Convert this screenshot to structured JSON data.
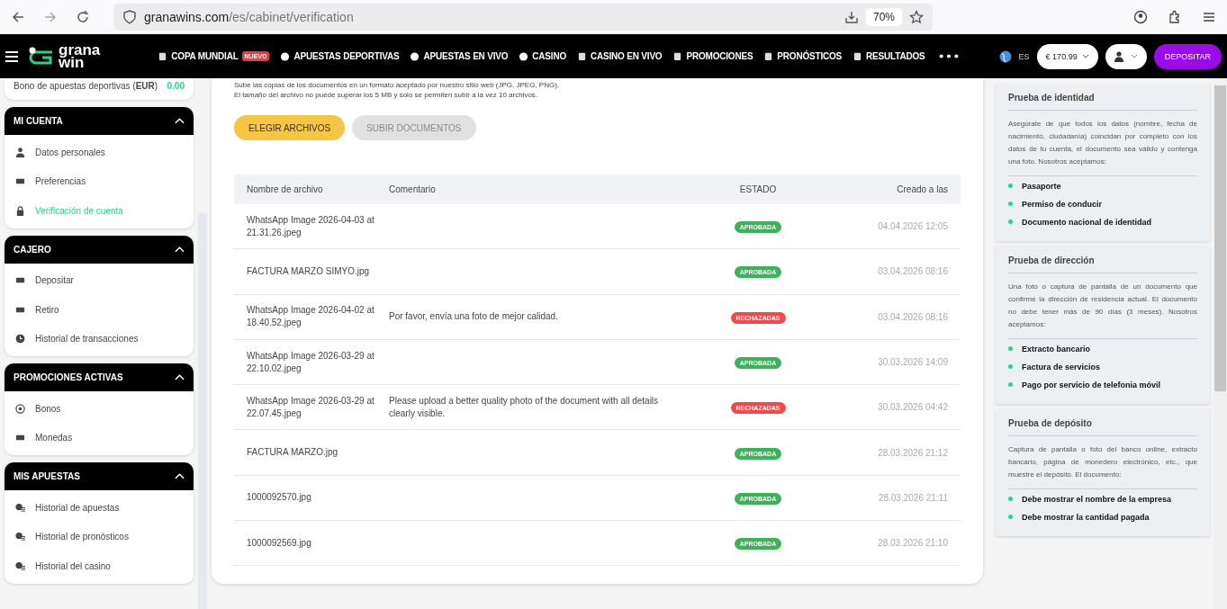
{
  "browser": {
    "url_host": "granawins.com",
    "url_path": "/es/cabinet/verification",
    "zoom": "70%"
  },
  "header": {
    "logo": [
      "grana",
      "win"
    ],
    "nav": [
      {
        "label": "COPA MUNDIAL",
        "badge": "NUEVO"
      },
      {
        "label": "APUESTAS DEPORTIVAS"
      },
      {
        "label": "APUESTAS EN VIVO"
      },
      {
        "label": "CASINO"
      },
      {
        "label": "CASINO EN VIVO"
      },
      {
        "label": "PROMOCIONES"
      },
      {
        "label": "PRONÓSTICOS"
      },
      {
        "label": "RESULTADOS"
      }
    ],
    "language": "ES",
    "balance": "€ 170.99",
    "deposit": "DEPOSITAR"
  },
  "sidebar": {
    "bonus": {
      "label": "Bono de apuestas deportivas (**EUR**)",
      "value": "0.00"
    },
    "groups": [
      {
        "title": "MI CUENTA",
        "expanded": true,
        "items": [
          {
            "label": "Datos personales",
            "selected": false
          },
          {
            "label": "Preferencias",
            "selected": false
          },
          {
            "label": "Verificación de cuenta",
            "selected": true
          }
        ]
      },
      {
        "title": "CAJERO",
        "expanded": true,
        "items": [
          {
            "label": "Depositar",
            "selected": false
          },
          {
            "label": "Retiro",
            "selected": false
          },
          {
            "label": "Historial de transacciones",
            "selected": false
          }
        ]
      },
      {
        "title": "PROMOCIONES ACTIVAS",
        "expanded": true,
        "items": [
          {
            "label": "Bonos",
            "selected": false
          },
          {
            "label": "Monedas",
            "selected": false
          }
        ]
      },
      {
        "title": "MIS APUESTAS",
        "expanded": true,
        "items": [
          {
            "label": "Historial de apuestas",
            "selected": false
          },
          {
            "label": "Historial de pronósticos",
            "selected": false
          },
          {
            "label": "Historial del casino",
            "selected": false
          }
        ]
      }
    ]
  },
  "upload": {
    "notes": [
      "Sube las copias de los documentos en un formato aceptado por nuestro sitio web (JPG, JPEG, PNG).",
      "El tamaño del archivo no puede superar los 5 MB y solo se permiten subir a la vez 10 archivos."
    ],
    "buttons": [
      {
        "label": "ELEGIR ARCHIVOS",
        "disabled": false
      },
      {
        "label": "SUBIR DOCUMENTOS",
        "disabled": true
      }
    ]
  },
  "table": {
    "columns": [
      "Nombre de archivo",
      "Comentario",
      "ESTADO",
      "Creado a las"
    ],
    "rows": [
      {
        "file": "WhatsApp Image 2026-04-03 at 21.31.26.jpeg",
        "status": "APROBADA",
        "kind": "approved",
        "created": "04.04.2026 12:05"
      },
      {
        "file": "FACTURA MARZO SIMYO.jpg",
        "status": "APROBADA",
        "kind": "approved",
        "created": "03.04.2026 08:16"
      },
      {
        "file": "WhatsApp Image 2026-04-02 at 18.40.52.jpeg",
        "comment": "Por favor, envía una foto de mejor calidad.",
        "status": "RECHAZADAS",
        "kind": "rejected",
        "created": "03.04.2026 08:16"
      },
      {
        "file": "WhatsApp Image 2026-03-29 at 22.10.02.jpeg",
        "status": "APROBADA",
        "kind": "approved",
        "created": "30.03.2026 14:09"
      },
      {
        "file": "WhatsApp Image 2026-03-29 at 22.07.45.jpeg",
        "comment": "Please upload a better quality photo of the document with all details clearly visible.",
        "status": "RECHAZADAS",
        "kind": "rejected",
        "created": "30.03.2026 04:42"
      },
      {
        "file": "FACTURA MARZO.jpg",
        "status": "APROBADA",
        "kind": "approved",
        "created": "28.03.2026 21:12"
      },
      {
        "file": "1000092570.jpg",
        "status": "APROBADA",
        "kind": "approved",
        "created": "28.03.2026 21:11"
      },
      {
        "file": "1000092569.jpg",
        "status": "APROBADA",
        "kind": "approved",
        "created": "28.03.2026 21:10"
      }
    ]
  },
  "info_cards": [
    {
      "title": "Prueba de identidad",
      "text": "Asegúrate de que todos los datos (nombre, fecha de nacimiento, ciudadanía) coincidan por completo con los datos de tu cuenta, el documento sea válido y contenga una foto. Nosotros aceptamos:",
      "items": [
        "Pasaporte",
        "Permiso de conducir",
        "Documento nacional de identidad"
      ]
    },
    {
      "title": "Prueba de dirección",
      "text": "Una foto o captura de pantalla de un documento que confirme la dirección de residencia actual. El documento no debe tener más de 90 días (3 meses). Nosotros aceptamos:",
      "items": [
        "Extracto bancario",
        "Factura de servicios",
        "Pago por servicio de telefonia móvil"
      ]
    },
    {
      "title": "Prueba de depósito",
      "text": "Captura de pantalla o foto del banco online, extracto bancario, página de monedero electrónico, etc., que muestre el depósito. El documento:",
      "items": [
        "Debe mostrar el nombre de la empresa",
        "Debe mostrar la cantidad pagada"
      ]
    }
  ]
}
